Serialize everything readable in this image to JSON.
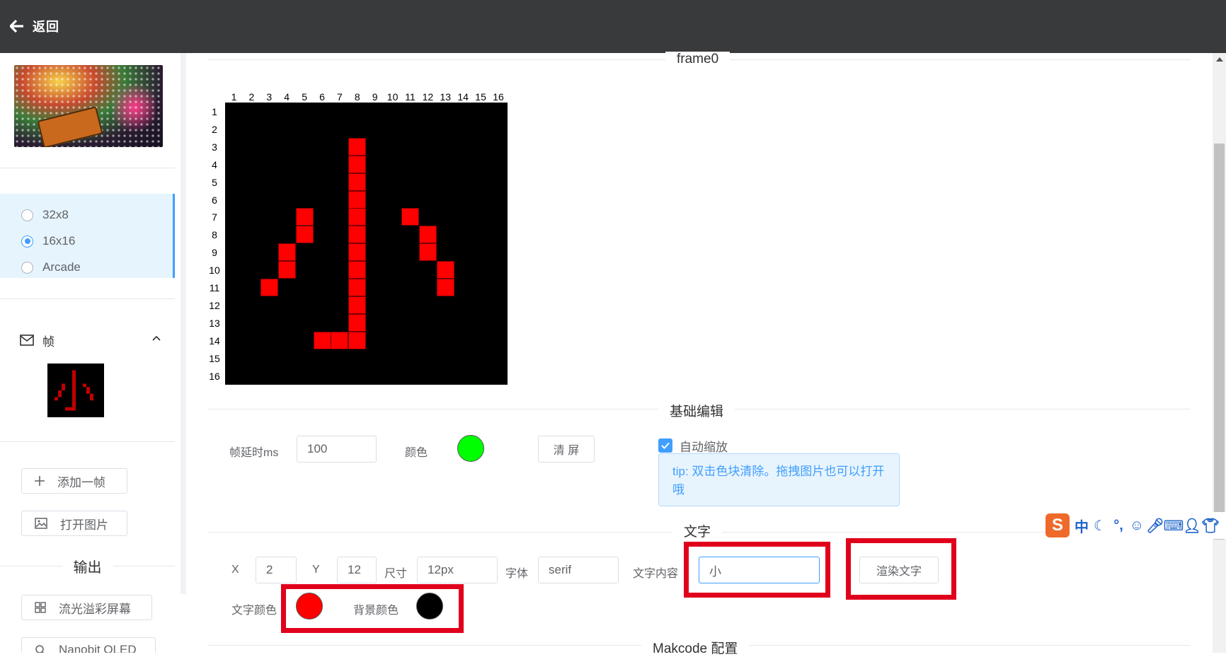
{
  "topbar": {
    "back_label": "返回"
  },
  "sidebar": {
    "size_options": [
      {
        "label": "32x8",
        "selected": false
      },
      {
        "label": "16x16",
        "selected": true
      },
      {
        "label": "Arcade",
        "selected": false
      }
    ],
    "frames_label": "帧",
    "add_frame_label": "添加一帧",
    "open_image_label": "打开图片",
    "output_label": "输出",
    "output_items": [
      "流光溢彩屏幕",
      "Nanobit OLED"
    ]
  },
  "frame": {
    "title": "frame0",
    "columns": [
      "1",
      "2",
      "3",
      "4",
      "5",
      "6",
      "7",
      "8",
      "9",
      "10",
      "11",
      "12",
      "13",
      "14",
      "15",
      "16"
    ],
    "rows": [
      "1",
      "2",
      "3",
      "4",
      "5",
      "6",
      "7",
      "8",
      "9",
      "10",
      "11",
      "12",
      "13",
      "14",
      "15",
      "16"
    ],
    "background_color": "#000000",
    "pixel_color": "#ff0000",
    "lit_pixels": [
      [
        3,
        8
      ],
      [
        4,
        8
      ],
      [
        5,
        8
      ],
      [
        6,
        8
      ],
      [
        7,
        5
      ],
      [
        7,
        8
      ],
      [
        7,
        11
      ],
      [
        8,
        5
      ],
      [
        8,
        8
      ],
      [
        8,
        12
      ],
      [
        9,
        4
      ],
      [
        9,
        8
      ],
      [
        9,
        12
      ],
      [
        10,
        4
      ],
      [
        10,
        8
      ],
      [
        10,
        13
      ],
      [
        11,
        3
      ],
      [
        11,
        8
      ],
      [
        11,
        13
      ],
      [
        12,
        8
      ],
      [
        13,
        8
      ],
      [
        14,
        6
      ],
      [
        14,
        7
      ],
      [
        14,
        8
      ]
    ]
  },
  "basic_edit": {
    "title": "基础编辑",
    "delay_label": "帧延时ms",
    "delay_value": "100",
    "color_label": "颜色",
    "color_value": "#00ff00",
    "clear_label": "清 屏",
    "auto_scale_label": "自动缩放",
    "auto_scale_checked": true,
    "tip": "tip: 双击色块清除。拖拽图片也可以打开哦"
  },
  "text_section": {
    "title": "文字",
    "x_label": "X",
    "x_value": "2",
    "y_label": "Y",
    "y_value": "12",
    "size_label": "尺寸",
    "size_value": "12px",
    "font_label": "字体",
    "font_value": "serif",
    "content_label": "文字内容",
    "content_value": "小",
    "render_label": "渲染文字",
    "text_color_label": "文字颜色",
    "text_color": "#ff0000",
    "bg_color_label": "背景颜色",
    "bg_color": "#000000"
  },
  "makecode": {
    "title": "Makcode 配置"
  },
  "ime": {
    "mode": "中"
  },
  "colors": {
    "accent": "#409eff",
    "highlight": "#e1001c",
    "topbar": "#393a3c"
  }
}
